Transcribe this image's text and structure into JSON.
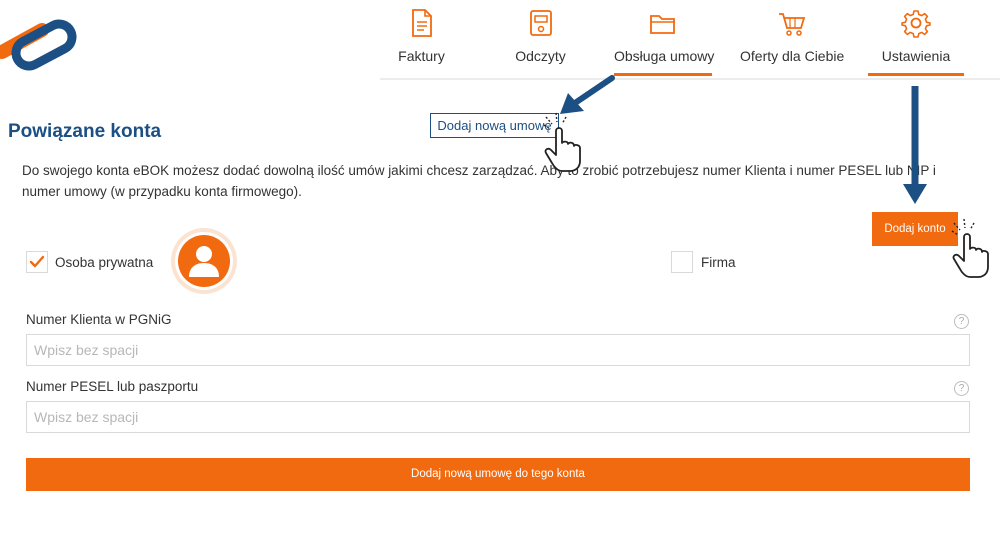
{
  "nav": {
    "items": [
      {
        "label": "Faktury",
        "icon": "invoice-icon"
      },
      {
        "label": "Odczyty",
        "icon": "meter-icon"
      },
      {
        "label": "Obsługa umowy",
        "icon": "folder-icon",
        "active": true
      },
      {
        "label": "Oferty dla Ciebie",
        "icon": "cart-icon"
      },
      {
        "label": "Ustawienia",
        "icon": "gear-icon",
        "active": true
      }
    ]
  },
  "page": {
    "title": "Powiązane konta",
    "add_contract_link": "Dodaj nową umowę",
    "description": "Do swojego konta eBOK możesz dodać dowolną ilość umów jakimi chcesz zarządzać. Aby to zrobić potrzebujesz numer Klienta i numer PESEL lub NIP i numer umowy (w przypadku konta firmowego).",
    "add_account_button": "Dodaj konto"
  },
  "account_type": {
    "private_label": "Osoba prywatna",
    "private_checked": true,
    "company_label": "Firma",
    "company_checked": false
  },
  "form": {
    "client_number_label": "Numer Klienta w PGNiG",
    "client_number_placeholder": "Wpisz bez spacji",
    "client_number_value": "",
    "pesel_label": "Numer PESEL lub paszportu",
    "pesel_placeholder": "Wpisz bez spacji",
    "pesel_value": "",
    "help_glyph": "?",
    "submit_label": "Dodaj nową umowę do tego konta"
  },
  "colors": {
    "accent": "#f26a0f",
    "brand_blue": "#1c4f83"
  }
}
